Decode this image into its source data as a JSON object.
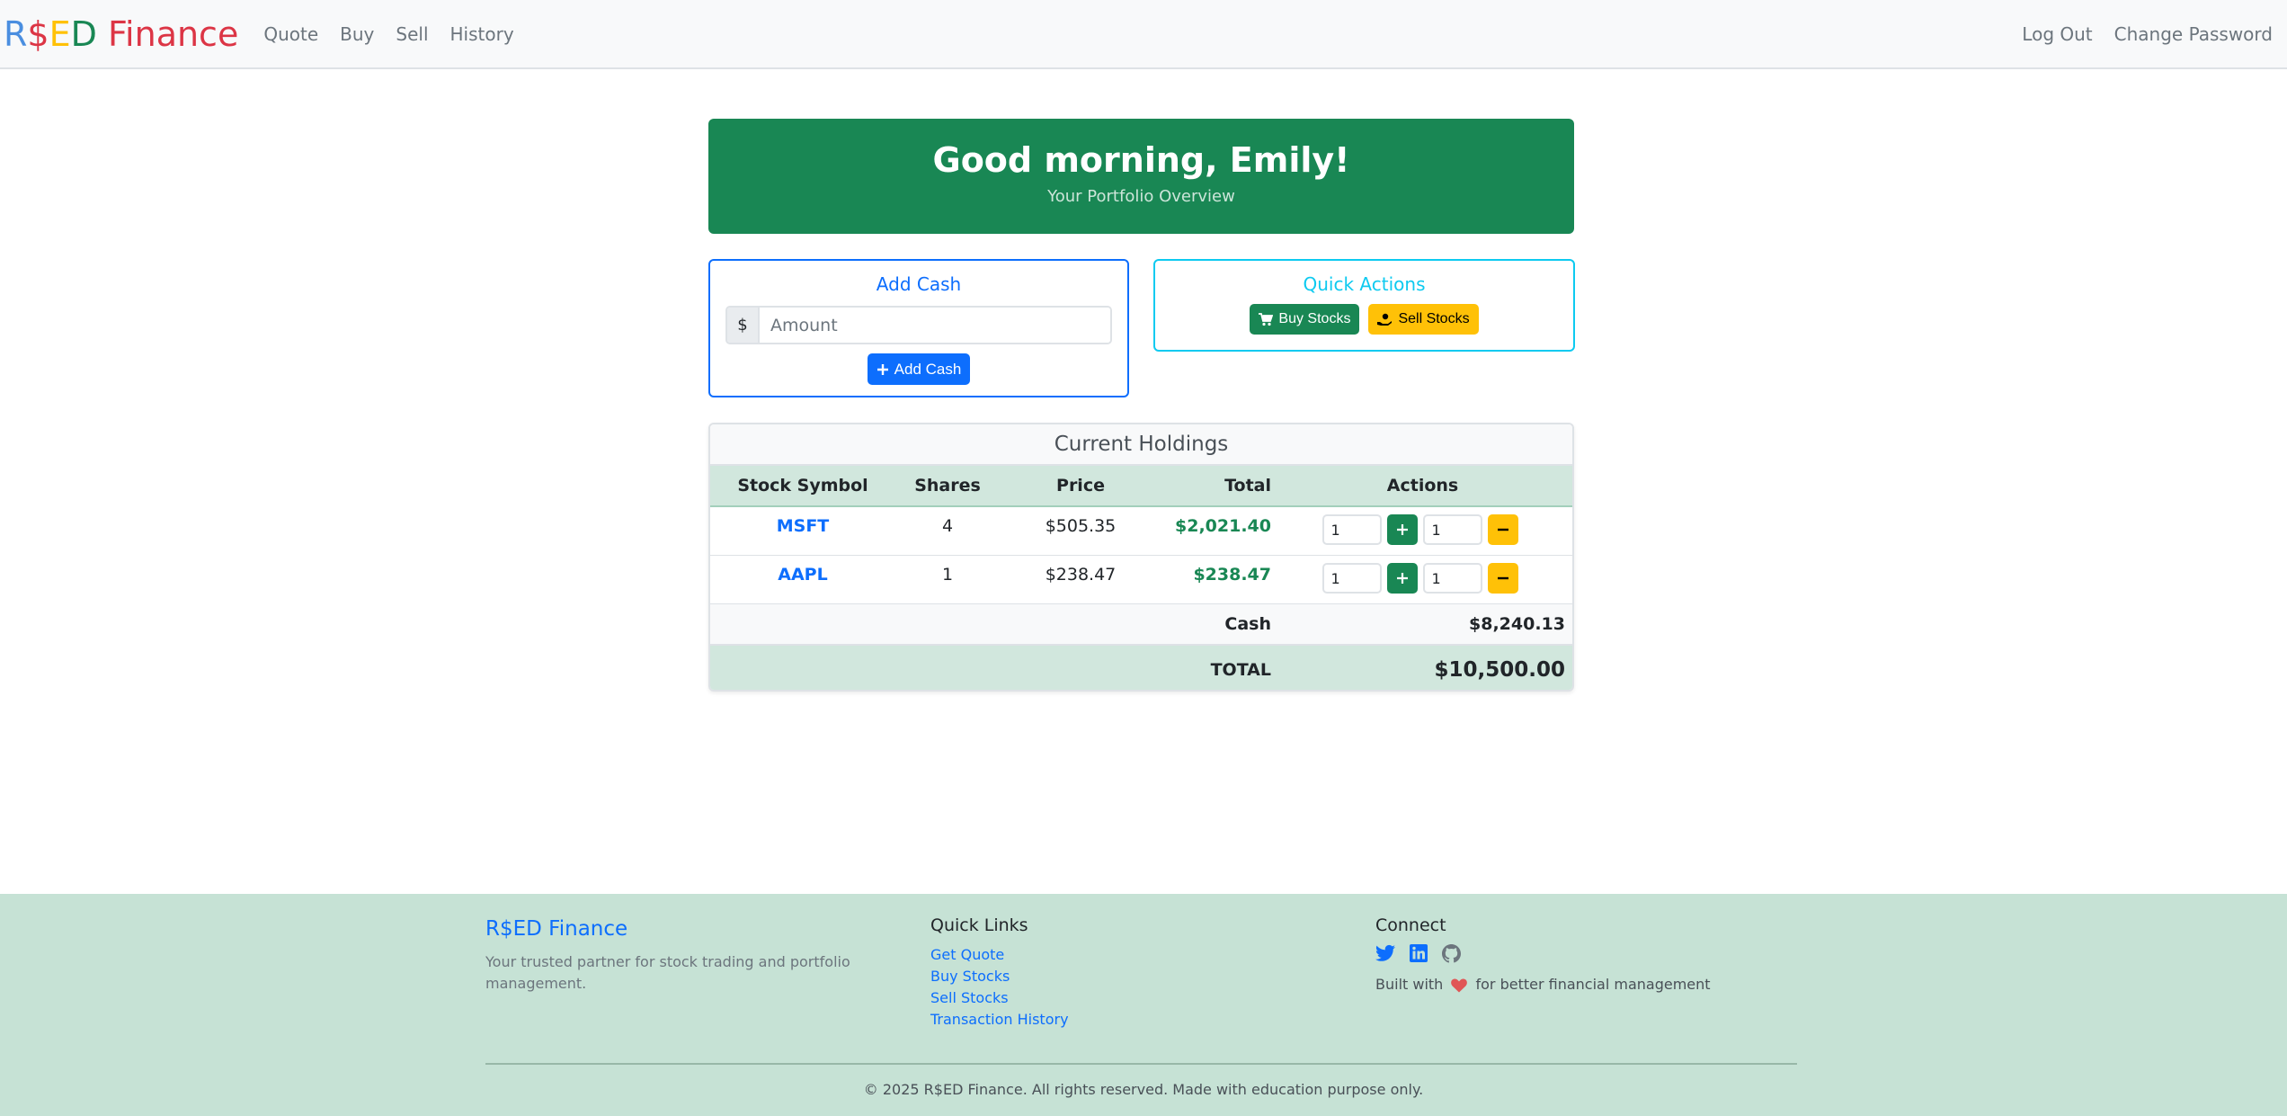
{
  "navbar": {
    "brand": {
      "r": "R",
      "dollar": "$",
      "e": "E",
      "d": "D",
      "finance": " Finance"
    },
    "brand_colors": {
      "r": "#4a8ee0",
      "dollar": "#dc3545",
      "e": "#ffc107",
      "d": "#198754",
      "finance": "#dc3545"
    },
    "links": [
      "Quote",
      "Buy",
      "Sell",
      "History"
    ],
    "right_links": [
      "Log Out",
      "Change Password"
    ]
  },
  "hero": {
    "greeting": "Good morning, Emily!",
    "subtitle": "Your Portfolio Overview"
  },
  "add_cash": {
    "title": "Add Cash",
    "currency": "$",
    "placeholder": "Amount",
    "button": "Add Cash"
  },
  "quick_actions": {
    "title": "Quick Actions",
    "buy": "Buy Stocks",
    "sell": "Sell Stocks"
  },
  "holdings": {
    "title": "Current Holdings",
    "columns": [
      "Stock Symbol",
      "Shares",
      "Price",
      "Total",
      "Actions"
    ],
    "rows": [
      {
        "symbol": "MSFT",
        "shares": "4",
        "price": "$505.35",
        "total": "$2,021.40",
        "buy_qty": "1",
        "sell_qty": "1"
      },
      {
        "symbol": "AAPL",
        "shares": "1",
        "price": "$238.47",
        "total": "$238.47",
        "buy_qty": "1",
        "sell_qty": "1"
      }
    ],
    "cash_label": "Cash",
    "cash_value": "$8,240.13",
    "total_label": "TOTAL",
    "total_value": "$10,500.00"
  },
  "footer": {
    "brand": "R$ED Finance",
    "description": "Your trusted partner for stock trading and portfolio management.",
    "quick_links_title": "Quick Links",
    "quick_links": [
      "Get Quote",
      "Buy Stocks",
      "Sell Stocks",
      "Transaction History"
    ],
    "connect_title": "Connect",
    "built_prefix": "Built with",
    "built_suffix": "for better financial management",
    "copyright": "© 2025 R$ED Finance. All rights reserved. Made with education purpose only."
  },
  "colors": {
    "primary": "#0d6efd",
    "success": "#198754",
    "warning": "#ffc107",
    "info": "#0dcaf0"
  }
}
